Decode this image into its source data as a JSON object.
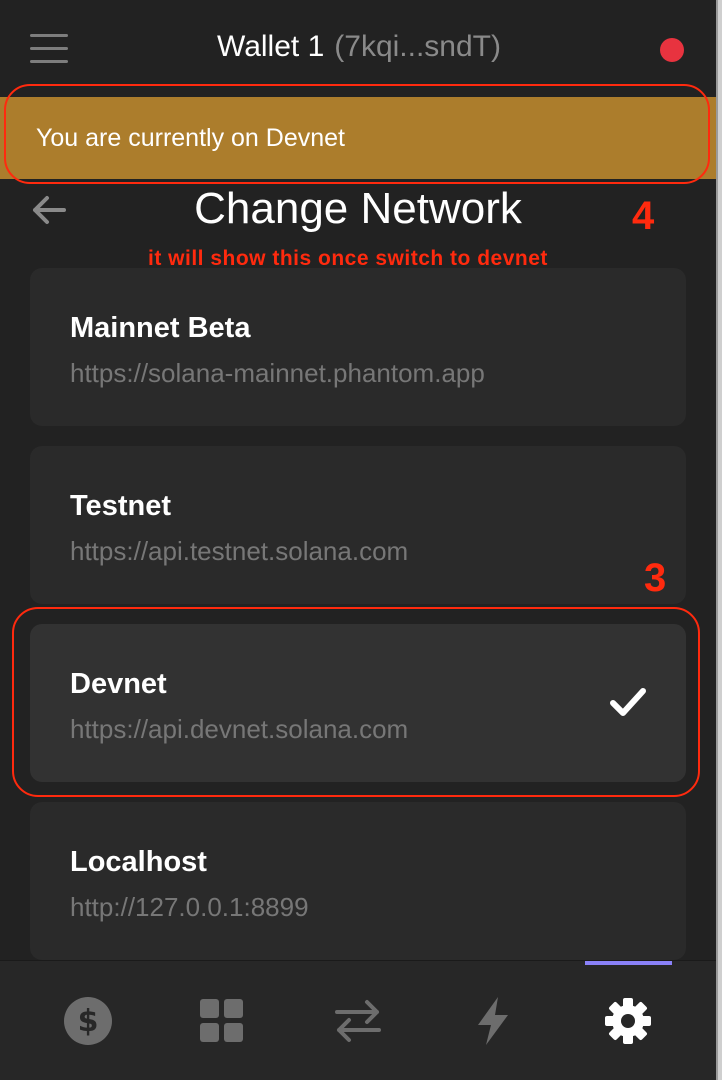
{
  "header": {
    "wallet_name": "Wallet 1",
    "wallet_address": "(7kqi...sndT)",
    "status_color": "#e8333f"
  },
  "banner": {
    "text": "You are currently on Devnet",
    "color": "#ac7d2c"
  },
  "page": {
    "title": "Change Network"
  },
  "annotations": {
    "box_4_number": "4",
    "box_4_note": "it will show this once switch to devnet",
    "box_3_number": "3",
    "color": "#ff2a0e"
  },
  "networks": [
    {
      "name": "Mainnet Beta",
      "url": "https://solana-mainnet.phantom.app",
      "selected": false
    },
    {
      "name": "Testnet",
      "url": "https://api.testnet.solana.com",
      "selected": false
    },
    {
      "name": "Devnet",
      "url": "https://api.devnet.solana.com",
      "selected": true
    },
    {
      "name": "Localhost",
      "url": "http://127.0.0.1:8899",
      "selected": false
    }
  ],
  "bottom_nav": {
    "items": [
      {
        "icon": "dollar-icon",
        "active": false
      },
      {
        "icon": "grid-icon",
        "active": false
      },
      {
        "icon": "swap-icon",
        "active": false
      },
      {
        "icon": "lightning-icon",
        "active": false
      },
      {
        "icon": "gear-icon",
        "active": true
      }
    ],
    "accent_color": "#8a81f8"
  }
}
